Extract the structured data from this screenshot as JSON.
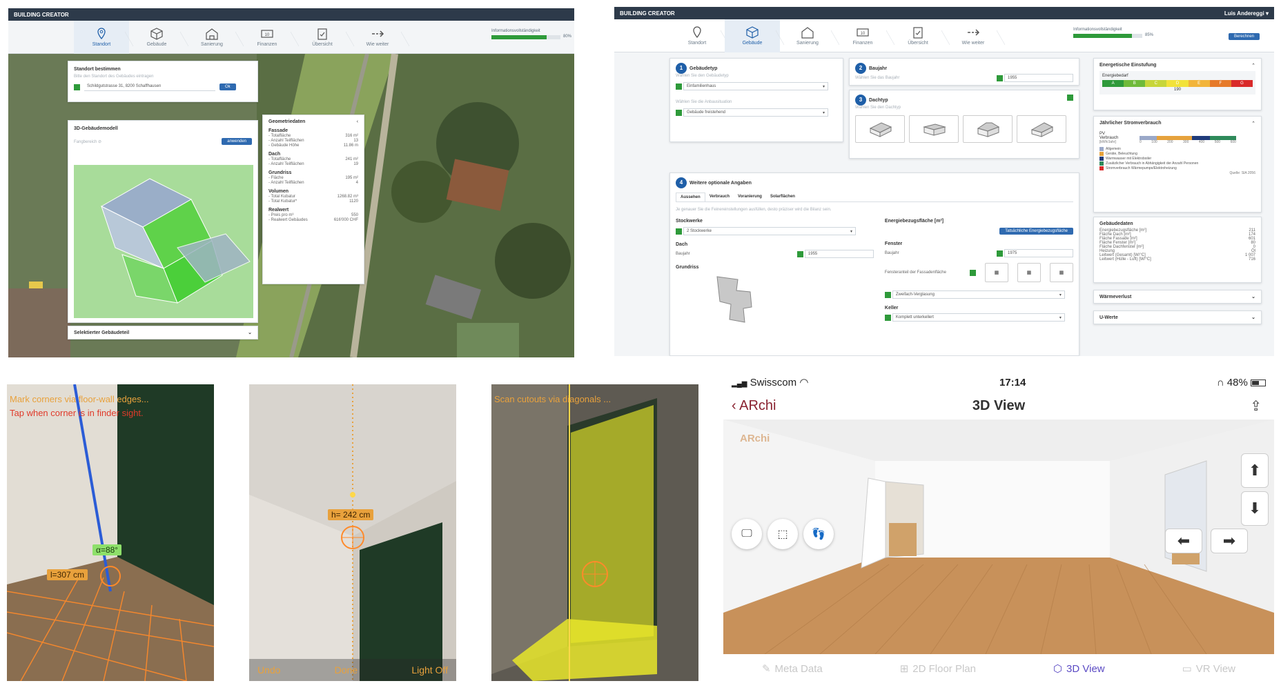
{
  "panel1": {
    "app_title": "BUILDING CREATOR",
    "steps": [
      "Standort",
      "Gebäude",
      "Sanierung",
      "Finanzen",
      "Übersicht",
      "Wie weiter"
    ],
    "progress_label": "Informationsvollständigkeit",
    "progress_value": "80%",
    "progress_fraction": 0.8,
    "location": {
      "title": "Standort bestimmen",
      "hint": "Bitte den Standort des Gebäudes eintragen",
      "address": "Schildgutstrasse 31, 8200 Schaffhausen",
      "ok": "Ok"
    },
    "model": {
      "title": "3D-Gebäudemodell",
      "toggle": "Fangbereich",
      "button": "anwenden"
    },
    "dropdown": "Selektierter Gebäudeteil",
    "geometry": {
      "title": "Geometriedaten",
      "sections": [
        {
          "name": "Fassade",
          "rows": [
            [
              "- Totalfläche",
              "316 m²"
            ],
            [
              "- Anzahl Teilflächen",
              "13"
            ],
            [
              "- Gebäude Höhe",
              "11.86 m"
            ]
          ]
        },
        {
          "name": "Dach",
          "rows": [
            [
              "- Totalfläche",
              "241 m²"
            ],
            [
              "- Anzahl Teilflächen",
              "19"
            ]
          ]
        },
        {
          "name": "Grundriss",
          "rows": [
            [
              "- Fläche",
              "195 m²"
            ],
            [
              "- Anzahl Teilflächen",
              "4"
            ]
          ]
        },
        {
          "name": "Volumen",
          "rows": [
            [
              "- Total Kubatur",
              "1268.82 m³"
            ],
            [
              "- Total Kubatur*",
              "1120"
            ]
          ]
        },
        {
          "name": "Realwert",
          "rows": [
            [
              "- Preis pro m³",
              "550"
            ],
            [
              "- Realwert Gebäudes",
              "616'000 CHF"
            ]
          ]
        }
      ]
    }
  },
  "panel2": {
    "app_title": "BUILDING CREATOR",
    "user": "Luis Andereggi",
    "steps": [
      "Standort",
      "Gebäude",
      "Sanierung",
      "Finanzen",
      "Übersicht",
      "Wie weiter"
    ],
    "progress_label": "Informationsvollständigkeit",
    "progress_value": "85%",
    "progress_fraction": 0.85,
    "save": "Berechnen",
    "gebaeudetyp": {
      "title": "Gebäudetyp",
      "hint": "Wählen Sie den Gebäudetyp",
      "value": "Einfamilienhaus",
      "hint2": "Wählen Sie die Anbausituation",
      "value2": "Gebäude freistehend"
    },
    "baujahr": {
      "title": "Baujahr",
      "hint": "Wählen Sie das Baujahr",
      "value": "1955"
    },
    "dachtyp": {
      "title": "Dachtyp",
      "hint": "Wählen Sie den Dachtyp"
    },
    "optional": {
      "title": "Weitere optionale Angaben",
      "tabs": [
        "Aussehen",
        "Verbrauch",
        "Voranierung",
        "Solarflächen"
      ],
      "hint": "Je genauer Sie die Feinereinstellungen ausfüllen, desto präziser wird die Bilanz sein.",
      "stockwerke_label": "Stockwerke",
      "stockwerke_value": "2 Stockwerke",
      "dach": "Dach",
      "baujahr": "Baujahr",
      "dach_year": "1955",
      "grundriss": "Grundriss",
      "ebf": "Energiebezugsfläche [m²]",
      "ebf_button": "Tatsächliche Energiebezugsfläche",
      "fenster": "Fenster",
      "fenster_baujahr": "Baujahr",
      "fenster_year": "1975",
      "fensteranteil": "Fensteranteil der Fassadenfläche",
      "verglasung": "Zweifach-Verglasung",
      "keller": "Keller",
      "keller_value": "Komplett unterkellert"
    },
    "energy": {
      "title": "Energetische Einstufung",
      "sub": "Energiebedarf",
      "value": "190",
      "classes": [
        "A",
        "B",
        "C",
        "D",
        "E",
        "F",
        "G"
      ]
    },
    "strom": {
      "title": "Jährlicher Stromverbrauch",
      "pv": "PV",
      "verbrauch": "Verbrauch",
      "unit": "[kWh/Jahr]",
      "ticks": [
        "0",
        "100",
        "200",
        "300",
        "400",
        "500",
        "600"
      ],
      "legend": [
        "Allgemein",
        "Geräte, Beleuchtung",
        "Warmwasser mit Elektroboiler",
        "Zusätzlicher Verbrauch in Abhängigkeit der Anzahl Personen",
        "Stromverbrauch Wärmepumpe/Elektroheizung"
      ],
      "source": "Quelle: SIA 2056"
    },
    "gebaeudedaten": {
      "title": "Gebäudedaten",
      "rows": [
        [
          "Energiebezugsfläche [m²]",
          "211"
        ],
        [
          "Fläche Dach [m²]",
          "174"
        ],
        [
          "Fläche Fassade [m²]",
          "601"
        ],
        [
          "Fläche Fenster [m²]",
          "80"
        ],
        [
          "Fläche Dachfenster [m²]",
          "0"
        ],
        [
          "Heizung",
          "Öl"
        ],
        [
          "Leitwert (Gesamt) [W/°C]",
          "1 007"
        ],
        [
          "Leitwert (Hülle - Luft) [W/°C]",
          "716"
        ]
      ]
    },
    "waermeverlust": "Wärmeverlust",
    "uwerte": "U-Werte"
  },
  "ar1": {
    "line1": "Mark corners via floor-wall edges...",
    "line2": "Tap when corner is in finder sight.",
    "angle": "α=88°",
    "length": "l=307 cm"
  },
  "ar2": {
    "height": "h= 242 cm",
    "undo": "Undo",
    "done": "Done",
    "light": "Light Off"
  },
  "ar3": {
    "hint": "Scan cutouts via diagonals ..."
  },
  "phone": {
    "carrier": "Swisscom",
    "time": "17:14",
    "battery": "48%",
    "back": "ARchi",
    "title": "3D View",
    "watermark": "ARchi",
    "tabs": [
      {
        "label": "Meta Data",
        "active": false
      },
      {
        "label": "2D Floor Plan",
        "active": false
      },
      {
        "label": "3D View",
        "active": true
      },
      {
        "label": "VR View",
        "active": false
      }
    ],
    "accent": "#5b4bc4"
  }
}
